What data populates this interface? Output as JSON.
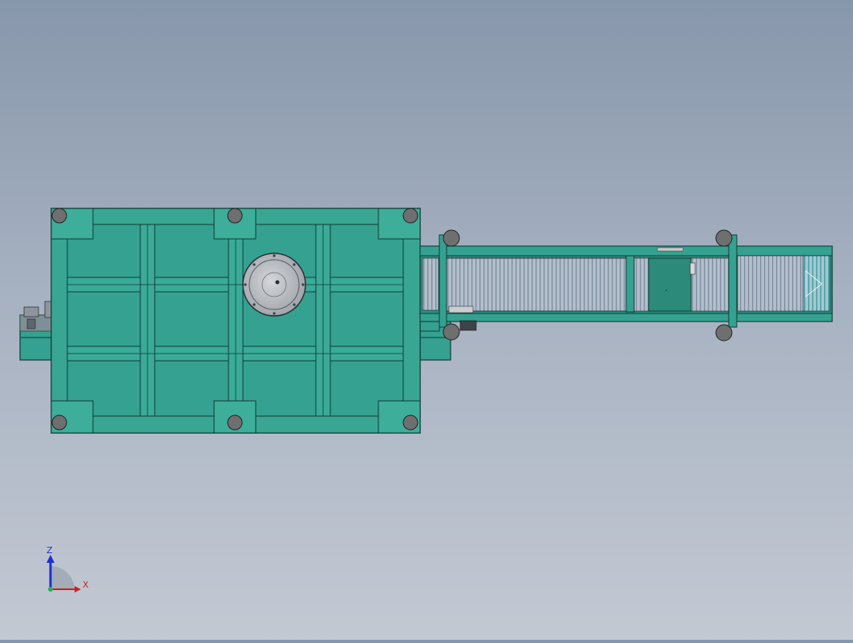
{
  "viewport": {
    "background_top": "#8797ab",
    "background_bottom": "#c3c9d3"
  },
  "model": {
    "frame_color": "#35a190",
    "frame_edge": "#0e3b33",
    "bolt_color": "#6e706f",
    "roller_color": "#b6c2cf"
  },
  "triad": {
    "z_label": "Z",
    "x_label": "X",
    "z_color": "#1f2fd0",
    "x_color": "#d21f1f",
    "y_color": "#22b14c"
  }
}
